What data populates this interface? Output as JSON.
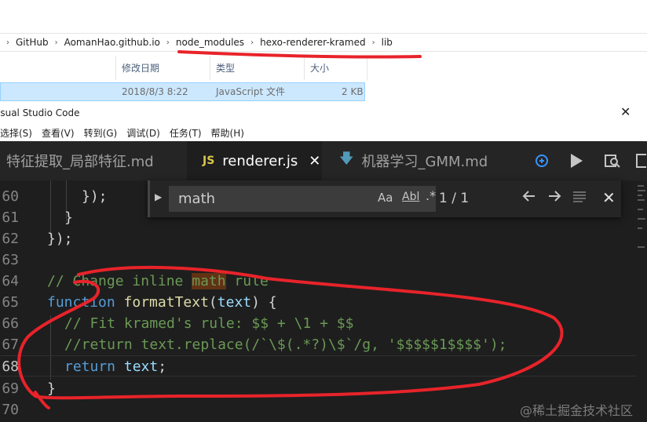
{
  "explorer": {
    "breadcrumb": [
      "GitHub",
      "AomanHao.github.io",
      "node_modules",
      "hexo-renderer-kramed",
      "lib"
    ],
    "columns": {
      "date": "修改日期",
      "type": "类型",
      "size": "大小"
    },
    "file": {
      "date": "2018/8/3 8:22",
      "type": "JavaScript 文件",
      "size": "2 KB"
    }
  },
  "window": {
    "title": "isual Studio Code",
    "close": "✕"
  },
  "menu": [
    "选择(S)",
    "查看(V)",
    "转到(G)",
    "调试(D)",
    "任务(T)",
    "帮助(H)"
  ],
  "tabs": [
    {
      "label": "特征提取_局部特征.md"
    },
    {
      "label": "renderer.js",
      "icon": "JS",
      "close": "✕"
    },
    {
      "label": "机器学习_GMM.md"
    }
  ],
  "find": {
    "value": "math",
    "match_case": "Aa",
    "whole_word": "Abl",
    "regex": ".*",
    "count": "1 / 1"
  },
  "editor": {
    "line_numbers": [
      "60",
      "61",
      "62",
      "63",
      "64",
      "65",
      "66",
      "67",
      "68",
      "69",
      "70"
    ],
    "lines": {
      "l60": "});",
      "l61": "}",
      "l62": "});",
      "l64_pre": "// Change inline ",
      "l64_hl": "math",
      "l64_post": " rule",
      "l65_kw": "function",
      "l65_fn": "formatText",
      "l65_prm": "text",
      "l65_end": ") {",
      "l66": "// Fit kramed's rule: $$ + \\1 + $$",
      "l67": "//return text.replace(/`\\$(.*?)\\$`/g, '$$$$$1$$$$');",
      "l68_kw": "return",
      "l68_prm": "text",
      "l69": "}"
    }
  },
  "watermark": "@稀土掘金技术社区",
  "colors": {
    "annotation": "#e8232a",
    "editor_bg": "#1e1e1e",
    "selection": "#cce8ff"
  }
}
